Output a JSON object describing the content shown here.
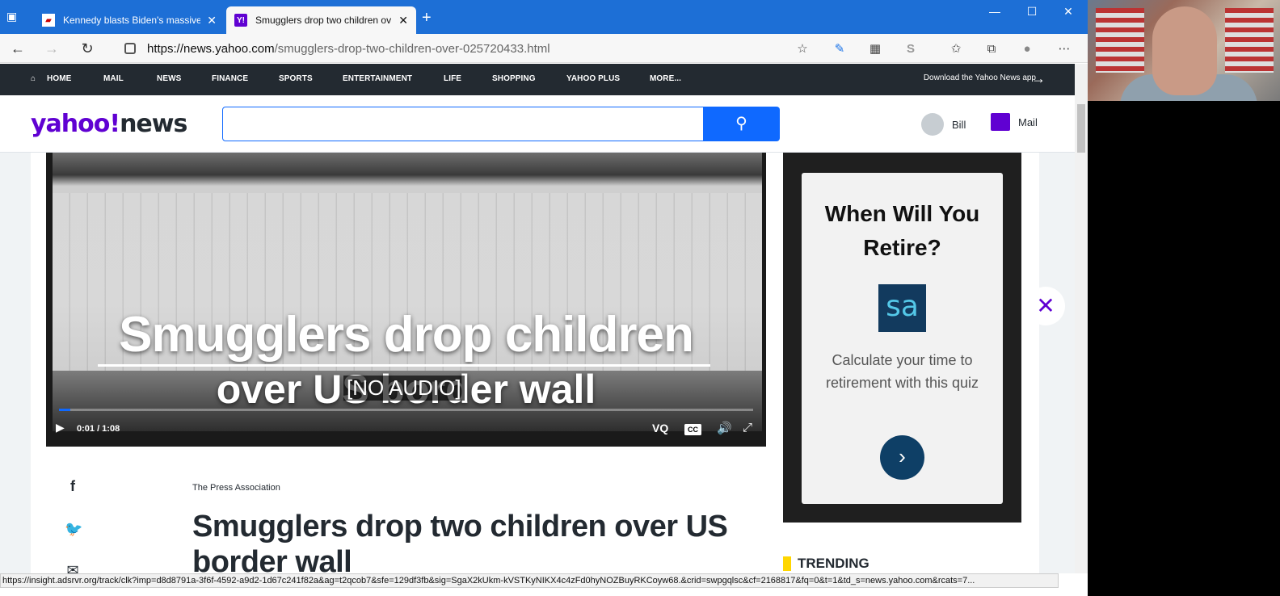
{
  "browser": {
    "tabs": [
      {
        "title": "Kennedy blasts Biden's massive",
        "active": false
      },
      {
        "title": "Smugglers drop two children ov",
        "active": true
      }
    ],
    "url_host": "https://news.yahoo.com",
    "url_path": "/smugglers-drop-two-children-over-025720433.html",
    "status_url": "https://insight.adsrvr.org/track/clk?imp=d8d8791a-3f6f-4592-a9d2-1d67c241f82a&ag=t2qcob7&sfe=129df3fb&sig=SgaX2kUkm-kVSTKyNIKX4c4zFd0hyNOZBuyRKCoyw68.&crid=swpgqlsc&cf=2168817&fq=0&t=1&td_s=news.yahoo.com&rcats=7..."
  },
  "yahoo_nav": {
    "items": [
      "HOME",
      "MAIL",
      "NEWS",
      "FINANCE",
      "SPORTS",
      "ENTERTAINMENT",
      "LIFE",
      "SHOPPING",
      "YAHOO PLUS",
      "MORE..."
    ],
    "app_link": "Download the Yahoo News app"
  },
  "header": {
    "logo_yahoo": "yahoo!",
    "logo_news": "news",
    "search_placeholder": "",
    "user_name": "Bill",
    "mail_label": "Mail"
  },
  "video": {
    "title_line1": "Smugglers drop children",
    "title_line2": "over US border wall",
    "caption": "[NO AUDIO]",
    "time": "0:01 / 1:08",
    "progress": 0.016,
    "vq_label": "VQ",
    "cc_label": "CC"
  },
  "article": {
    "provider": "The Press Association",
    "headline": "Smugglers drop two children over US border wall"
  },
  "ad": {
    "headline": "When Will You Retire?",
    "logo_text": "sa",
    "body": "Calculate your time to retirement with this quiz"
  },
  "sidebar": {
    "trending_label": "TRENDING"
  }
}
